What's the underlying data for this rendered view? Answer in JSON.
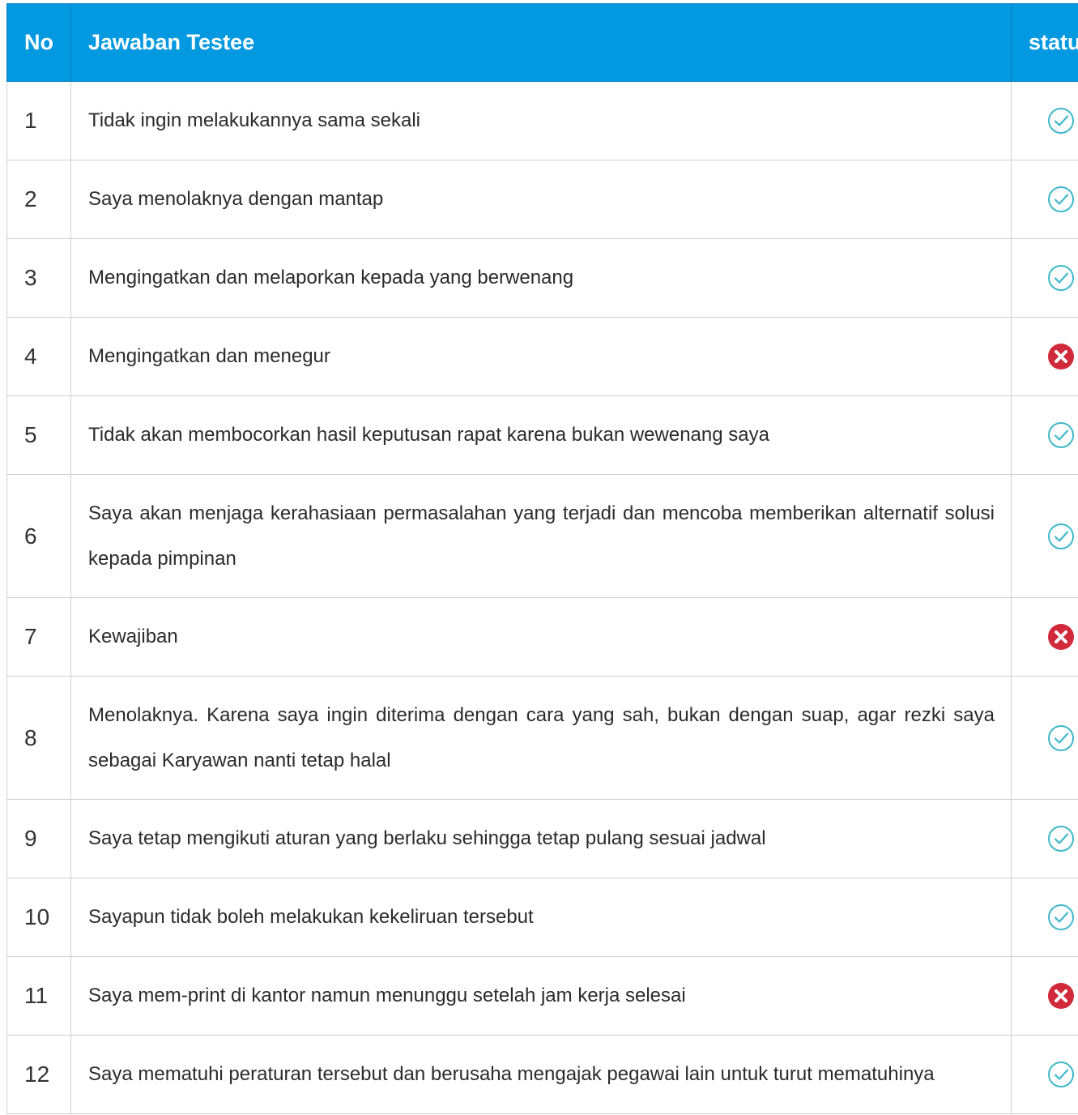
{
  "table": {
    "headers": {
      "no": "No",
      "answer": "Jawaban Testee",
      "status": "status"
    },
    "rows": [
      {
        "no": "1",
        "answer": "Tidak ingin melakukannya sama sekali",
        "status": "correct"
      },
      {
        "no": "2",
        "answer": "Saya menolaknya dengan mantap",
        "status": "correct"
      },
      {
        "no": "3",
        "answer": "Mengingatkan dan melaporkan kepada yang berwenang",
        "status": "correct"
      },
      {
        "no": "4",
        "answer": "Mengingatkan dan menegur",
        "status": "wrong"
      },
      {
        "no": "5",
        "answer": "Tidak akan membocorkan hasil keputusan rapat karena bukan wewenang saya",
        "status": "correct"
      },
      {
        "no": "6",
        "answer": "Saya akan menjaga kerahasiaan permasalahan yang terjadi dan mencoba memberikan alternatif solusi kepada pimpinan",
        "status": "correct"
      },
      {
        "no": "7",
        "answer": "Kewajiban",
        "status": "wrong"
      },
      {
        "no": "8",
        "answer": "Menolaknya. Karena saya ingin diterima dengan cara yang sah, bukan dengan suap, agar rezki saya sebagai Karyawan nanti tetap halal",
        "status": "correct"
      },
      {
        "no": "9",
        "answer": "Saya tetap mengikuti aturan yang berlaku sehingga tetap pulang sesuai jadwal",
        "status": "correct"
      },
      {
        "no": "10",
        "answer": "Sayapun tidak boleh melakukan kekeliruan tersebut",
        "status": "correct"
      },
      {
        "no": "11",
        "answer": "Saya mem-print di kantor namun menunggu setelah jam kerja selesai",
        "status": "wrong"
      },
      {
        "no": "12",
        "answer": "Saya mematuhi peraturan tersebut dan berusaha mengajak pegawai lain untuk turut mematuhinya",
        "status": "correct"
      }
    ]
  },
  "icons": {
    "correct": "check-circle-icon",
    "wrong": "x-circle-icon"
  },
  "colors": {
    "header_bg": "#0399e0",
    "check": "#3fb8c9",
    "cross": "#d0293a"
  }
}
